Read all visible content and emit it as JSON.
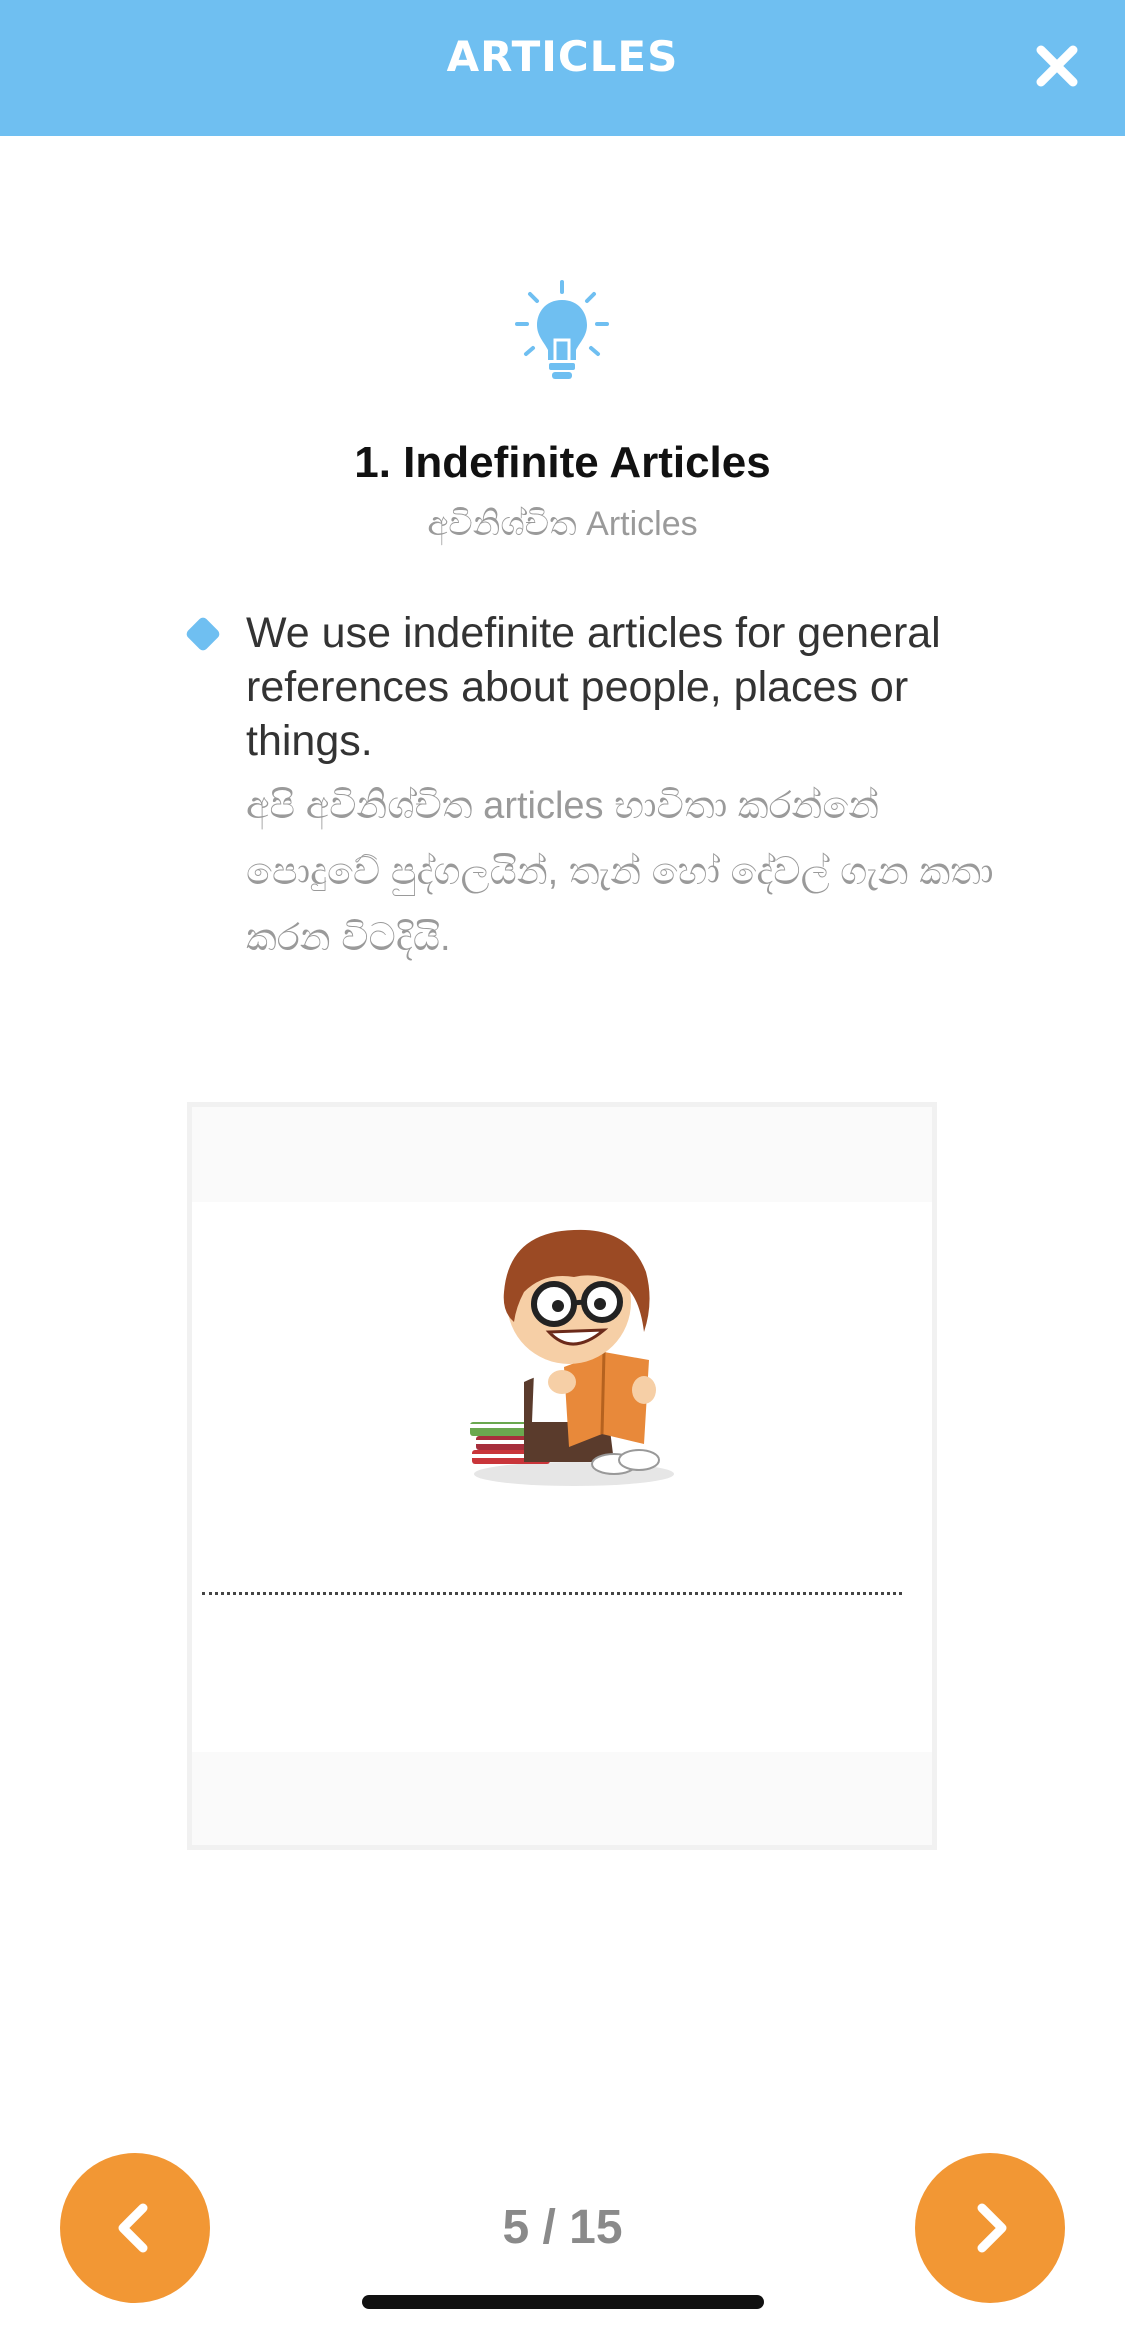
{
  "header": {
    "title": "ARTICLES",
    "close_icon": "close-icon"
  },
  "content": {
    "icon": "lightbulb-icon",
    "title": "1. Indefinite Articles",
    "subtitle": "අවිනිශ්චිත Articles",
    "bullet": {
      "text_en": "We use indefinite articles for general references about people, places or things.",
      "text_si": "අපි අවිනිශ්චිත articles භාවිතා කරන්නේ පොදුවේ පුද්ගලයින්, තැන් හෝ දේවල් ගැන කතා කරන විටදියි."
    },
    "illustration": "boy-reading-book-illustration"
  },
  "footer": {
    "prev_icon": "chevron-left-icon",
    "next_icon": "chevron-right-icon",
    "page_counter": "5 / 15"
  },
  "colors": {
    "header": "#6fbff1",
    "nav_button": "#f29734",
    "accent": "#6fbff1"
  }
}
